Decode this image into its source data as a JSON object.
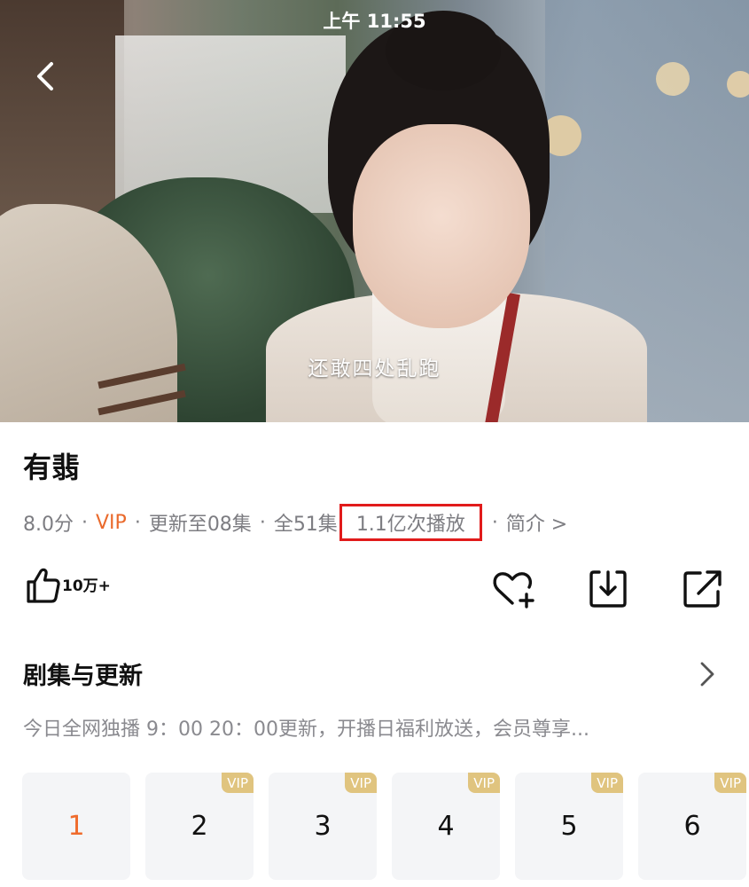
{
  "status_bar": {
    "time": "上午 11:55"
  },
  "video": {
    "subtitle": "还敢四处乱跑"
  },
  "show": {
    "title": "有翡",
    "rating": "8.0分",
    "vip": "VIP",
    "updated": "更新至08集",
    "total": "全51集",
    "views": "1.1亿次播放",
    "intro": "简介 >",
    "separator": "·"
  },
  "actions": {
    "like_count": "10万+"
  },
  "episodes_section": {
    "title": "剧集与更新",
    "description": "今日全网独播 9：00 20：00更新，开播日福利放送，会员尊享...",
    "episodes": [
      {
        "number": "1",
        "badge": ""
      },
      {
        "number": "2",
        "badge": "VIP"
      },
      {
        "number": "3",
        "badge": "VIP"
      },
      {
        "number": "4",
        "badge": "VIP"
      },
      {
        "number": "5",
        "badge": "VIP"
      },
      {
        "number": "6",
        "badge": "VIP"
      }
    ]
  },
  "colors": {
    "accent": "#EA6A2C",
    "vip_badge": "#E0C47F",
    "highlight_box": "#E11B1B"
  },
  "icons": [
    "back-icon",
    "thumbs-up-icon",
    "heart-plus-icon",
    "download-icon",
    "share-icon",
    "chevron-right-icon"
  ]
}
